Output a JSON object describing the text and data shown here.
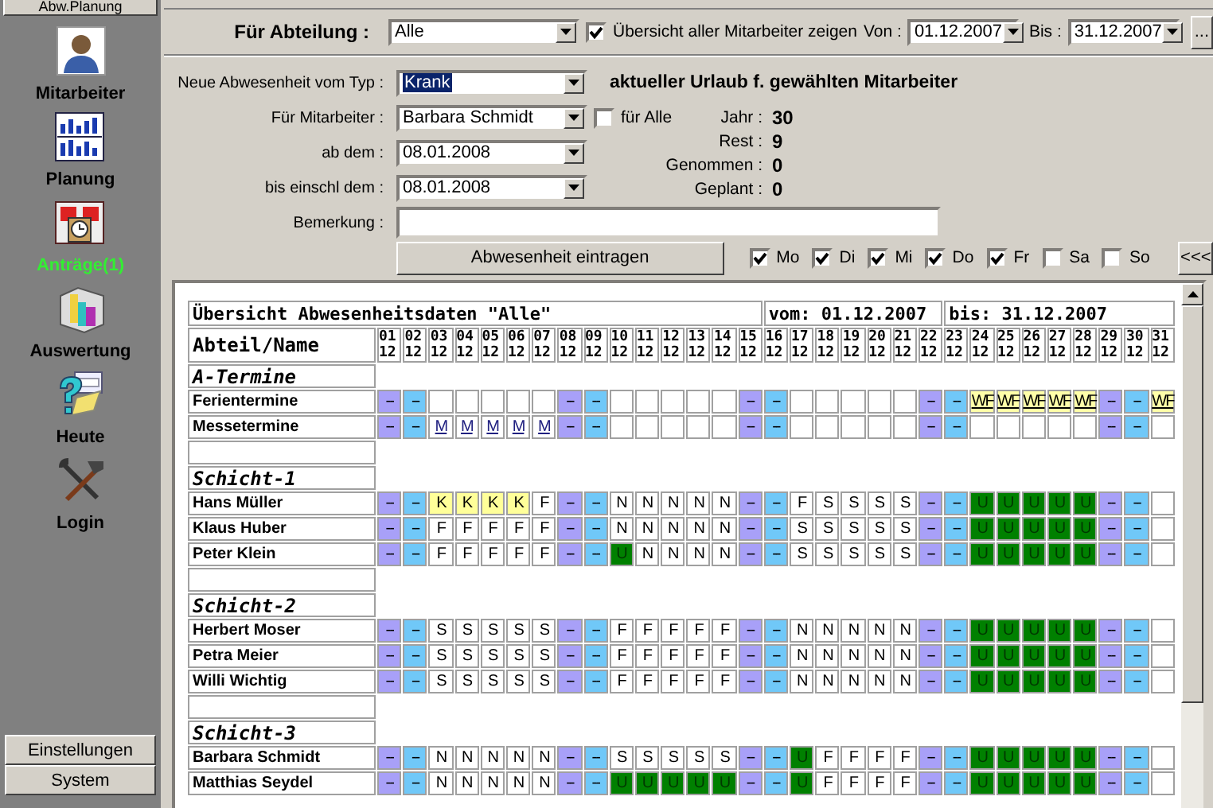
{
  "sidebar": {
    "header": "Abw.Planung",
    "items": [
      {
        "label": "Mitarbeiter",
        "alert": false
      },
      {
        "label": "Planung",
        "alert": false
      },
      {
        "label": "Anträge(1)",
        "alert": true
      },
      {
        "label": "Auswertung",
        "alert": false
      },
      {
        "label": "Heute",
        "alert": false
      },
      {
        "label": "Login",
        "alert": false
      }
    ],
    "bottom_buttons": [
      "Einstellungen",
      "System"
    ]
  },
  "department": {
    "label": "Für Abteilung :",
    "value": "Alle",
    "show_all": {
      "label": "Übersicht aller Mitarbeiter zeigen",
      "checked": true
    },
    "from": {
      "label": "Von :",
      "value": "01.12.2007"
    },
    "to": {
      "label": "Bis :",
      "value": "31.12.2007"
    },
    "more_button": "..."
  },
  "new_absence": {
    "type": {
      "label": "Neue Abwesenheit vom Typ :",
      "value": "Krank",
      "highlighted": true
    },
    "employee": {
      "label": "Für Mitarbeiter :",
      "value": "Barbara Schmidt",
      "highlighted": false
    },
    "for_all": {
      "label": "für Alle",
      "checked": false
    },
    "start": {
      "label": "ab dem :",
      "value": "08.01.2008",
      "highlighted": false
    },
    "end": {
      "label": "bis einschl dem :",
      "value": "08.01.2008",
      "highlighted": false
    },
    "remark": {
      "label": "Bemerkung :"
    },
    "submit": "Abwesenheit eintragen",
    "weekdays": [
      {
        "label": "Mo",
        "checked": true
      },
      {
        "label": "Di",
        "checked": true
      },
      {
        "label": "Mi",
        "checked": true
      },
      {
        "label": "Do",
        "checked": true
      },
      {
        "label": "Fr",
        "checked": true
      },
      {
        "label": "Sa",
        "checked": false
      },
      {
        "label": "So",
        "checked": false
      }
    ],
    "collapse_button": "<<<"
  },
  "vacation": {
    "title": "aktueller Urlaub f. gewählten Mitarbeiter",
    "stats": [
      {
        "label": "Jahr :",
        "value": "30"
      },
      {
        "label": "Rest :",
        "value": "9"
      },
      {
        "label": "Genommen :",
        "value": "0"
      },
      {
        "label": "Geplant :",
        "value": "0"
      }
    ]
  },
  "overview": {
    "title": "Übersicht Abwesenheitsdaten \"Alle\"",
    "from": "vom: 01.12.2007",
    "to": "bis: 31.12.2007",
    "name_header": "Abteil/Name",
    "days": [
      {
        "day": "01",
        "month": "12"
      },
      {
        "day": "02",
        "month": "12"
      },
      {
        "day": "03",
        "month": "12"
      },
      {
        "day": "04",
        "month": "12"
      },
      {
        "day": "05",
        "month": "12"
      },
      {
        "day": "06",
        "month": "12"
      },
      {
        "day": "07",
        "month": "12"
      },
      {
        "day": "08",
        "month": "12"
      },
      {
        "day": "09",
        "month": "12"
      },
      {
        "day": "10",
        "month": "12"
      },
      {
        "day": "11",
        "month": "12"
      },
      {
        "day": "12",
        "month": "12"
      },
      {
        "day": "13",
        "month": "12"
      },
      {
        "day": "14",
        "month": "12"
      },
      {
        "day": "15",
        "month": "12"
      },
      {
        "day": "16",
        "month": "12"
      },
      {
        "day": "17",
        "month": "12"
      },
      {
        "day": "18",
        "month": "12"
      },
      {
        "day": "19",
        "month": "12"
      },
      {
        "day": "20",
        "month": "12"
      },
      {
        "day": "21",
        "month": "12"
      },
      {
        "day": "22",
        "month": "12"
      },
      {
        "day": "23",
        "month": "12"
      },
      {
        "day": "24",
        "month": "12"
      },
      {
        "day": "25",
        "month": "12"
      },
      {
        "day": "26",
        "month": "12"
      },
      {
        "day": "27",
        "month": "12"
      },
      {
        "day": "28",
        "month": "12"
      },
      {
        "day": "29",
        "month": "12"
      },
      {
        "day": "30",
        "month": "12"
      },
      {
        "day": "31",
        "month": "12"
      }
    ],
    "rows": [
      {
        "kind": "group",
        "name": "A-Termine"
      },
      {
        "kind": "entry",
        "name": "Ferientermine",
        "cells": [
          {
            "text": "--",
            "kind": "sa"
          },
          {
            "text": "--",
            "kind": "so"
          },
          {
            "kind": "empty"
          },
          {
            "kind": "empty"
          },
          {
            "kind": "empty"
          },
          {
            "kind": "empty"
          },
          {
            "kind": "empty"
          },
          {
            "text": "--",
            "kind": "sa"
          },
          {
            "text": "--",
            "kind": "so"
          },
          {
            "kind": "empty"
          },
          {
            "kind": "empty"
          },
          {
            "kind": "empty"
          },
          {
            "kind": "empty"
          },
          {
            "kind": "empty"
          },
          {
            "text": "--",
            "kind": "sa"
          },
          {
            "text": "--",
            "kind": "so"
          },
          {
            "kind": "empty"
          },
          {
            "kind": "empty"
          },
          {
            "kind": "empty"
          },
          {
            "kind": "empty"
          },
          {
            "kind": "empty"
          },
          {
            "text": "--",
            "kind": "sa"
          },
          {
            "text": "--",
            "kind": "so"
          },
          {
            "text": "WF",
            "kind": "holiday"
          },
          {
            "text": "WF",
            "kind": "holiday"
          },
          {
            "text": "WF",
            "kind": "holiday"
          },
          {
            "text": "WF",
            "kind": "holiday"
          },
          {
            "text": "WF",
            "kind": "holiday"
          },
          {
            "text": "--",
            "kind": "sa"
          },
          {
            "text": "--",
            "kind": "so"
          },
          {
            "text": "WF",
            "kind": "holiday"
          }
        ]
      },
      {
        "kind": "entry",
        "name": "Messetermine",
        "cells": [
          {
            "text": "--",
            "kind": "sa"
          },
          {
            "text": "--",
            "kind": "so"
          },
          {
            "text": "M",
            "kind": "fair"
          },
          {
            "text": "M",
            "kind": "fair"
          },
          {
            "text": "M",
            "kind": "fair"
          },
          {
            "text": "M",
            "kind": "fair"
          },
          {
            "text": "M",
            "kind": "fair"
          },
          {
            "text": "--",
            "kind": "sa"
          },
          {
            "text": "--",
            "kind": "so"
          },
          {
            "kind": "empty"
          },
          {
            "kind": "empty"
          },
          {
            "kind": "empty"
          },
          {
            "kind": "empty"
          },
          {
            "kind": "empty"
          },
          {
            "text": "--",
            "kind": "sa"
          },
          {
            "text": "--",
            "kind": "so"
          },
          {
            "kind": "empty"
          },
          {
            "kind": "empty"
          },
          {
            "kind": "empty"
          },
          {
            "kind": "empty"
          },
          {
            "kind": "empty"
          },
          {
            "text": "--",
            "kind": "sa"
          },
          {
            "text": "--",
            "kind": "so"
          },
          {
            "kind": "empty"
          },
          {
            "kind": "empty"
          },
          {
            "kind": "empty"
          },
          {
            "kind": "empty"
          },
          {
            "kind": "empty"
          },
          {
            "text": "--",
            "kind": "sa"
          },
          {
            "text": "--",
            "kind": "so"
          },
          {
            "kind": "empty"
          }
        ]
      },
      {
        "kind": "spacer"
      },
      {
        "kind": "group",
        "name": "Schicht-1"
      },
      {
        "kind": "entry",
        "name": "Hans Müller",
        "cells": [
          {
            "text": "--",
            "kind": "sa"
          },
          {
            "text": "--",
            "kind": "so"
          },
          {
            "text": "K",
            "kind": "sick"
          },
          {
            "text": "K",
            "kind": "sick"
          },
          {
            "text": "K",
            "kind": "sick"
          },
          {
            "text": "K",
            "kind": "sick"
          },
          {
            "text": "F",
            "kind": "shift"
          },
          {
            "text": "--",
            "kind": "sa"
          },
          {
            "text": "--",
            "kind": "so"
          },
          {
            "text": "N",
            "kind": "shift"
          },
          {
            "text": "N",
            "kind": "shift"
          },
          {
            "text": "N",
            "kind": "shift"
          },
          {
            "text": "N",
            "kind": "shift"
          },
          {
            "text": "N",
            "kind": "shift"
          },
          {
            "text": "--",
            "kind": "sa"
          },
          {
            "text": "--",
            "kind": "so"
          },
          {
            "text": "F",
            "kind": "shift"
          },
          {
            "text": "S",
            "kind": "shift"
          },
          {
            "text": "S",
            "kind": "shift"
          },
          {
            "text": "S",
            "kind": "shift"
          },
          {
            "text": "S",
            "kind": "shift"
          },
          {
            "text": "--",
            "kind": "sa"
          },
          {
            "text": "--",
            "kind": "so"
          },
          {
            "text": "U",
            "kind": "vacation"
          },
          {
            "text": "U",
            "kind": "vacation"
          },
          {
            "text": "U",
            "kind": "vacation"
          },
          {
            "text": "U",
            "kind": "vacation"
          },
          {
            "text": "U",
            "kind": "vacation"
          },
          {
            "text": "--",
            "kind": "sa"
          },
          {
            "text": "--",
            "kind": "so"
          },
          {
            "kind": "empty"
          }
        ]
      },
      {
        "kind": "entry",
        "name": "Klaus Huber",
        "cells": [
          {
            "text": "--",
            "kind": "sa"
          },
          {
            "text": "--",
            "kind": "so"
          },
          {
            "text": "F",
            "kind": "shift"
          },
          {
            "text": "F",
            "kind": "shift"
          },
          {
            "text": "F",
            "kind": "shift"
          },
          {
            "text": "F",
            "kind": "shift"
          },
          {
            "text": "F",
            "kind": "shift"
          },
          {
            "text": "--",
            "kind": "sa"
          },
          {
            "text": "--",
            "kind": "so"
          },
          {
            "text": "N",
            "kind": "shift"
          },
          {
            "text": "N",
            "kind": "shift"
          },
          {
            "text": "N",
            "kind": "shift"
          },
          {
            "text": "N",
            "kind": "shift"
          },
          {
            "text": "N",
            "kind": "shift"
          },
          {
            "text": "--",
            "kind": "sa"
          },
          {
            "text": "--",
            "kind": "so"
          },
          {
            "text": "S",
            "kind": "shift"
          },
          {
            "text": "S",
            "kind": "shift"
          },
          {
            "text": "S",
            "kind": "shift"
          },
          {
            "text": "S",
            "kind": "shift"
          },
          {
            "text": "S",
            "kind": "shift"
          },
          {
            "text": "--",
            "kind": "sa"
          },
          {
            "text": "--",
            "kind": "so"
          },
          {
            "text": "U",
            "kind": "vacation"
          },
          {
            "text": "U",
            "kind": "vacation"
          },
          {
            "text": "U",
            "kind": "vacation"
          },
          {
            "text": "U",
            "kind": "vacation"
          },
          {
            "text": "U",
            "kind": "vacation"
          },
          {
            "text": "--",
            "kind": "sa"
          },
          {
            "text": "--",
            "kind": "so"
          },
          {
            "kind": "empty"
          }
        ]
      },
      {
        "kind": "entry",
        "name": "Peter Klein",
        "cells": [
          {
            "text": "--",
            "kind": "sa"
          },
          {
            "text": "--",
            "kind": "so"
          },
          {
            "text": "F",
            "kind": "shift"
          },
          {
            "text": "F",
            "kind": "shift"
          },
          {
            "text": "F",
            "kind": "shift"
          },
          {
            "text": "F",
            "kind": "shift"
          },
          {
            "text": "F",
            "kind": "shift"
          },
          {
            "text": "--",
            "kind": "sa"
          },
          {
            "text": "--",
            "kind": "so"
          },
          {
            "text": "U",
            "kind": "vacation"
          },
          {
            "text": "N",
            "kind": "shift"
          },
          {
            "text": "N",
            "kind": "shift"
          },
          {
            "text": "N",
            "kind": "shift"
          },
          {
            "text": "N",
            "kind": "shift"
          },
          {
            "text": "--",
            "kind": "sa"
          },
          {
            "text": "--",
            "kind": "so"
          },
          {
            "text": "S",
            "kind": "shift"
          },
          {
            "text": "S",
            "kind": "shift"
          },
          {
            "text": "S",
            "kind": "shift"
          },
          {
            "text": "S",
            "kind": "shift"
          },
          {
            "text": "S",
            "kind": "shift"
          },
          {
            "text": "--",
            "kind": "sa"
          },
          {
            "text": "--",
            "kind": "so"
          },
          {
            "text": "U",
            "kind": "vacation"
          },
          {
            "text": "U",
            "kind": "vacation"
          },
          {
            "text": "U",
            "kind": "vacation"
          },
          {
            "text": "U",
            "kind": "vacation"
          },
          {
            "text": "U",
            "kind": "vacation"
          },
          {
            "text": "--",
            "kind": "sa"
          },
          {
            "text": "--",
            "kind": "so"
          },
          {
            "kind": "empty"
          }
        ]
      },
      {
        "kind": "spacer"
      },
      {
        "kind": "group",
        "name": "Schicht-2"
      },
      {
        "kind": "entry",
        "name": "Herbert Moser",
        "cells": [
          {
            "text": "--",
            "kind": "sa"
          },
          {
            "text": "--",
            "kind": "so"
          },
          {
            "text": "S",
            "kind": "shift"
          },
          {
            "text": "S",
            "kind": "shift"
          },
          {
            "text": "S",
            "kind": "shift"
          },
          {
            "text": "S",
            "kind": "shift"
          },
          {
            "text": "S",
            "kind": "shift"
          },
          {
            "text": "--",
            "kind": "sa"
          },
          {
            "text": "--",
            "kind": "so"
          },
          {
            "text": "F",
            "kind": "shift"
          },
          {
            "text": "F",
            "kind": "shift"
          },
          {
            "text": "F",
            "kind": "shift"
          },
          {
            "text": "F",
            "kind": "shift"
          },
          {
            "text": "F",
            "kind": "shift"
          },
          {
            "text": "--",
            "kind": "sa"
          },
          {
            "text": "--",
            "kind": "so"
          },
          {
            "text": "N",
            "kind": "shift"
          },
          {
            "text": "N",
            "kind": "shift"
          },
          {
            "text": "N",
            "kind": "shift"
          },
          {
            "text": "N",
            "kind": "shift"
          },
          {
            "text": "N",
            "kind": "shift"
          },
          {
            "text": "--",
            "kind": "sa"
          },
          {
            "text": "--",
            "kind": "so"
          },
          {
            "text": "U",
            "kind": "vacation"
          },
          {
            "text": "U",
            "kind": "vacation"
          },
          {
            "text": "U",
            "kind": "vacation"
          },
          {
            "text": "U",
            "kind": "vacation"
          },
          {
            "text": "U",
            "kind": "vacation"
          },
          {
            "text": "--",
            "kind": "sa"
          },
          {
            "text": "--",
            "kind": "so"
          },
          {
            "kind": "empty"
          }
        ]
      },
      {
        "kind": "entry",
        "name": "Petra Meier",
        "cells": [
          {
            "text": "--",
            "kind": "sa"
          },
          {
            "text": "--",
            "kind": "so"
          },
          {
            "text": "S",
            "kind": "shift"
          },
          {
            "text": "S",
            "kind": "shift"
          },
          {
            "text": "S",
            "kind": "shift"
          },
          {
            "text": "S",
            "kind": "shift"
          },
          {
            "text": "S",
            "kind": "shift"
          },
          {
            "text": "--",
            "kind": "sa"
          },
          {
            "text": "--",
            "kind": "so"
          },
          {
            "text": "F",
            "kind": "shift"
          },
          {
            "text": "F",
            "kind": "shift"
          },
          {
            "text": "F",
            "kind": "shift"
          },
          {
            "text": "F",
            "kind": "shift"
          },
          {
            "text": "F",
            "kind": "shift"
          },
          {
            "text": "--",
            "kind": "sa"
          },
          {
            "text": "--",
            "kind": "so"
          },
          {
            "text": "N",
            "kind": "shift"
          },
          {
            "text": "N",
            "kind": "shift"
          },
          {
            "text": "N",
            "kind": "shift"
          },
          {
            "text": "N",
            "kind": "shift"
          },
          {
            "text": "N",
            "kind": "shift"
          },
          {
            "text": "--",
            "kind": "sa"
          },
          {
            "text": "--",
            "kind": "so"
          },
          {
            "text": "U",
            "kind": "vacation"
          },
          {
            "text": "U",
            "kind": "vacation"
          },
          {
            "text": "U",
            "kind": "vacation"
          },
          {
            "text": "U",
            "kind": "vacation"
          },
          {
            "text": "U",
            "kind": "vacation"
          },
          {
            "text": "--",
            "kind": "sa"
          },
          {
            "text": "--",
            "kind": "so"
          },
          {
            "kind": "empty"
          }
        ]
      },
      {
        "kind": "entry",
        "name": "Willi Wichtig",
        "cells": [
          {
            "text": "--",
            "kind": "sa"
          },
          {
            "text": "--",
            "kind": "so"
          },
          {
            "text": "S",
            "kind": "shift"
          },
          {
            "text": "S",
            "kind": "shift"
          },
          {
            "text": "S",
            "kind": "shift"
          },
          {
            "text": "S",
            "kind": "shift"
          },
          {
            "text": "S",
            "kind": "shift"
          },
          {
            "text": "--",
            "kind": "sa"
          },
          {
            "text": "--",
            "kind": "so"
          },
          {
            "text": "F",
            "kind": "shift"
          },
          {
            "text": "F",
            "kind": "shift"
          },
          {
            "text": "F",
            "kind": "shift"
          },
          {
            "text": "F",
            "kind": "shift"
          },
          {
            "text": "F",
            "kind": "shift"
          },
          {
            "text": "--",
            "kind": "sa"
          },
          {
            "text": "--",
            "kind": "so"
          },
          {
            "text": "N",
            "kind": "shift"
          },
          {
            "text": "N",
            "kind": "shift"
          },
          {
            "text": "N",
            "kind": "shift"
          },
          {
            "text": "N",
            "kind": "shift"
          },
          {
            "text": "N",
            "kind": "shift"
          },
          {
            "text": "--",
            "kind": "sa"
          },
          {
            "text": "--",
            "kind": "so"
          },
          {
            "text": "U",
            "kind": "vacation"
          },
          {
            "text": "U",
            "kind": "vacation"
          },
          {
            "text": "U",
            "kind": "vacation"
          },
          {
            "text": "U",
            "kind": "vacation"
          },
          {
            "text": "U",
            "kind": "vacation"
          },
          {
            "text": "--",
            "kind": "sa"
          },
          {
            "text": "--",
            "kind": "so"
          },
          {
            "kind": "empty"
          }
        ]
      },
      {
        "kind": "spacer"
      },
      {
        "kind": "group",
        "name": "Schicht-3"
      },
      {
        "kind": "entry",
        "name": "Barbara Schmidt",
        "cells": [
          {
            "text": "--",
            "kind": "sa"
          },
          {
            "text": "--",
            "kind": "so"
          },
          {
            "text": "N",
            "kind": "shift"
          },
          {
            "text": "N",
            "kind": "shift"
          },
          {
            "text": "N",
            "kind": "shift"
          },
          {
            "text": "N",
            "kind": "shift"
          },
          {
            "text": "N",
            "kind": "shift"
          },
          {
            "text": "--",
            "kind": "sa"
          },
          {
            "text": "--",
            "kind": "so"
          },
          {
            "text": "S",
            "kind": "shift"
          },
          {
            "text": "S",
            "kind": "shift"
          },
          {
            "text": "S",
            "kind": "shift"
          },
          {
            "text": "S",
            "kind": "shift"
          },
          {
            "text": "S",
            "kind": "shift"
          },
          {
            "text": "--",
            "kind": "sa"
          },
          {
            "text": "--",
            "kind": "so"
          },
          {
            "text": "U",
            "kind": "vacation"
          },
          {
            "text": "F",
            "kind": "shift"
          },
          {
            "text": "F",
            "kind": "shift"
          },
          {
            "text": "F",
            "kind": "shift"
          },
          {
            "text": "F",
            "kind": "shift"
          },
          {
            "text": "--",
            "kind": "sa"
          },
          {
            "text": "--",
            "kind": "so"
          },
          {
            "text": "U",
            "kind": "vacation"
          },
          {
            "text": "U",
            "kind": "vacation"
          },
          {
            "text": "U",
            "kind": "vacation"
          },
          {
            "text": "U",
            "kind": "vacation"
          },
          {
            "text": "U",
            "kind": "vacation"
          },
          {
            "text": "--",
            "kind": "sa"
          },
          {
            "text": "--",
            "kind": "so"
          },
          {
            "kind": "empty"
          }
        ]
      },
      {
        "kind": "entry",
        "name": "Matthias Seydel",
        "cells": [
          {
            "text": "--",
            "kind": "sa"
          },
          {
            "text": "--",
            "kind": "so"
          },
          {
            "text": "N",
            "kind": "shift"
          },
          {
            "text": "N",
            "kind": "shift"
          },
          {
            "text": "N",
            "kind": "shift"
          },
          {
            "text": "N",
            "kind": "shift"
          },
          {
            "text": "N",
            "kind": "shift"
          },
          {
            "text": "--",
            "kind": "sa"
          },
          {
            "text": "--",
            "kind": "so"
          },
          {
            "text": "U",
            "kind": "vacation"
          },
          {
            "text": "U",
            "kind": "vacation"
          },
          {
            "text": "U",
            "kind": "vacation"
          },
          {
            "text": "U",
            "kind": "vacation"
          },
          {
            "text": "U",
            "kind": "vacation"
          },
          {
            "text": "--",
            "kind": "sa"
          },
          {
            "text": "--",
            "kind": "so"
          },
          {
            "text": "U",
            "kind": "vacation"
          },
          {
            "text": "F",
            "kind": "shift"
          },
          {
            "text": "F",
            "kind": "shift"
          },
          {
            "text": "F",
            "kind": "shift"
          },
          {
            "text": "F",
            "kind": "shift"
          },
          {
            "text": "--",
            "kind": "sa"
          },
          {
            "text": "--",
            "kind": "so"
          },
          {
            "text": "U",
            "kind": "vacation"
          },
          {
            "text": "U",
            "kind": "vacation"
          },
          {
            "text": "U",
            "kind": "vacation"
          },
          {
            "text": "U",
            "kind": "vacation"
          },
          {
            "text": "U",
            "kind": "vacation"
          },
          {
            "text": "--",
            "kind": "sa"
          },
          {
            "text": "--",
            "kind": "so"
          },
          {
            "kind": "empty"
          }
        ]
      }
    ]
  }
}
